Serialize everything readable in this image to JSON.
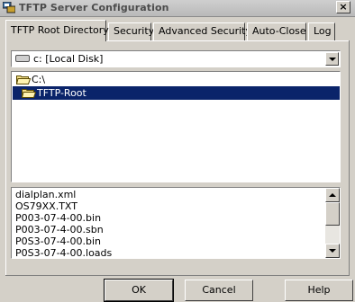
{
  "window": {
    "title": "TFTP Server Configuration",
    "close_label": "×"
  },
  "tabs": [
    {
      "label": "TFTP Root Directory",
      "active": true
    },
    {
      "label": "Security",
      "active": false
    },
    {
      "label": "Advanced Security",
      "active": false
    },
    {
      "label": "Auto-Close",
      "active": false
    },
    {
      "label": "Log",
      "active": false
    }
  ],
  "drive": {
    "selected": "c: [Local Disk]",
    "icon": "hard-drive-icon"
  },
  "folders": [
    {
      "label": "C:\\",
      "icon": "open-folder-icon",
      "selected": false
    },
    {
      "label": "TFTP-Root",
      "icon": "open-folder-icon",
      "selected": true
    }
  ],
  "files": [
    "dialplan.xml",
    "OS79XX.TXT",
    "P003-07-4-00.bin",
    "P003-07-4-00.sbn",
    "P0S3-07-4-00.bin",
    "P0S3-07-4-00.loads"
  ],
  "buttons": {
    "ok": "OK",
    "cancel": "Cancel",
    "help": "Help"
  },
  "colors": {
    "selection": "#0a246a",
    "face": "#d4d0c8"
  }
}
